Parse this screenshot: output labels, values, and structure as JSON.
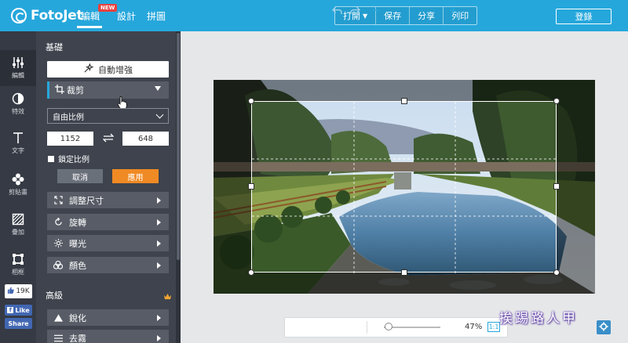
{
  "app": {
    "logo_text": "FotoJet"
  },
  "nav": {
    "edit": "編輯",
    "new_badge": "NEW",
    "design": "設計",
    "collage": "拼圖"
  },
  "toolbar": {
    "open": "打開",
    "save": "保存",
    "share": "分享",
    "print": "列印"
  },
  "login": "登錄",
  "rail": [
    {
      "label": "編輯",
      "icon": "sliders-icon"
    },
    {
      "label": "特效",
      "icon": "effects-icon"
    },
    {
      "label": "文字",
      "icon": "text-icon"
    },
    {
      "label": "剪貼畫",
      "icon": "clipart-icon"
    },
    {
      "label": "疊加",
      "icon": "overlay-icon"
    },
    {
      "label": "相框",
      "icon": "frame-icon"
    }
  ],
  "social": {
    "like_count": "19K",
    "fb_like": "Like",
    "fb_share": "Share"
  },
  "panel": {
    "basic_title": "基礎",
    "auto_enhance": "自動增強",
    "crop": "裁剪",
    "ratio_select": "自由比例",
    "width": "1152",
    "height": "648",
    "lock_ratio": "鎖定比例",
    "cancel": "取消",
    "apply": "應用",
    "resize": "調整尺寸",
    "rotate": "旋轉",
    "exposure": "曝光",
    "color": "顏色",
    "advanced_title": "高級",
    "sharpen": "銳化",
    "dehaze": "去霧"
  },
  "zoom": {
    "percent": "47%",
    "one_to_one": "1:1",
    "level": 0.08
  },
  "watermark": "挨踢路人甲",
  "colors": {
    "brand": "#26a7dc",
    "apply": "#f08a24",
    "panel": "#3e434d"
  }
}
